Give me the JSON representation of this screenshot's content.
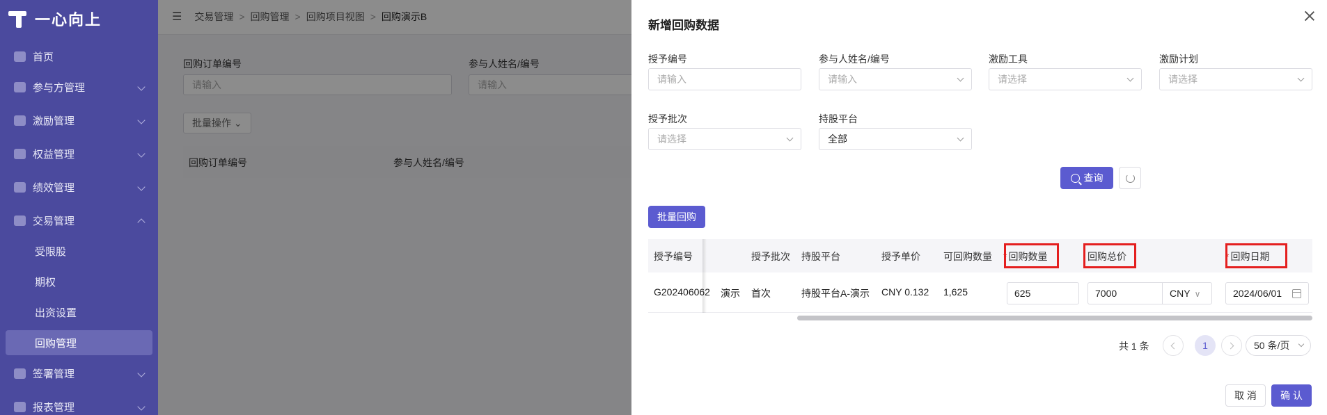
{
  "sidebar": {
    "logo_text": "一心向上",
    "items": [
      {
        "label": "首页"
      },
      {
        "label": "参与方管理"
      },
      {
        "label": "激励管理"
      },
      {
        "label": "权益管理"
      },
      {
        "label": "绩效管理"
      },
      {
        "label": "交易管理"
      },
      {
        "label": "签署管理"
      },
      {
        "label": "报表管理"
      }
    ],
    "sub_items": [
      {
        "label": "受限股"
      },
      {
        "label": "期权"
      },
      {
        "label": "出资设置"
      },
      {
        "label": "回购管理"
      }
    ]
  },
  "breadcrumb": [
    "交易管理",
    "回购管理",
    "回购项目视图",
    "回购演示B"
  ],
  "main": {
    "filter_labels": [
      "回购订单编号",
      "参与人姓名/编号"
    ],
    "filter_placeholders": [
      "请输入",
      "请输入"
    ],
    "batch_ops": "批量操作",
    "columns": [
      "回购订单编号",
      "参与人姓名/编号"
    ]
  },
  "drawer": {
    "title": "新增回购数据",
    "fields": [
      {
        "label": "授予编号",
        "placeholder": "请输入"
      },
      {
        "label": "参与人姓名/编号",
        "placeholder": "请输入"
      },
      {
        "label": "激励工具",
        "placeholder": "请选择"
      },
      {
        "label": "激励计划",
        "placeholder": "请选择"
      },
      {
        "label": "授予批次",
        "placeholder": "请选择"
      },
      {
        "label": "持股平台",
        "value": "全部"
      }
    ],
    "search_label": "查询",
    "batch_label": "批量回购",
    "table": {
      "columns": [
        "授予编号",
        "授予批次",
        "持股平台",
        "授予单价",
        "可回购数量",
        "回购数量",
        "回购总价",
        "回购日期"
      ],
      "required_mark": "*",
      "row": {
        "grant_no": "G202406062",
        "partial": "演示",
        "batch": "首次",
        "platform": "持股平台A-演示",
        "unit_price": "CNY 0.132",
        "available": "1,625",
        "qty": "625",
        "total": "7000",
        "currency": "CNY",
        "date": "2024/06/01"
      }
    },
    "pagination": {
      "total": "共 1 条",
      "current": "1",
      "page_size": "50 条/页"
    },
    "cancel_label": "取 消",
    "ok_label": "确 认"
  },
  "colors": {
    "primary": "#5b5bd0",
    "sidebar": "#4b4a9e",
    "highlight": "#e41f1f"
  }
}
